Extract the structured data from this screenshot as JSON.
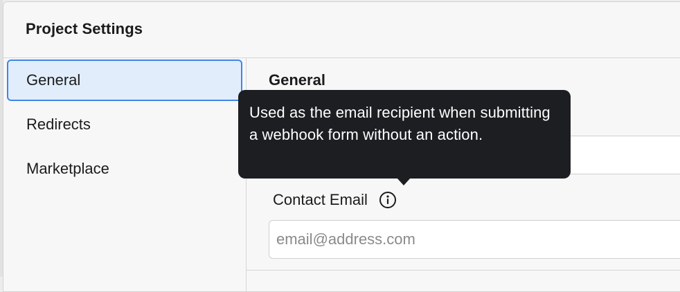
{
  "dialog": {
    "title": "Project Settings"
  },
  "sidebar": {
    "items": [
      {
        "label": "General",
        "active": true
      },
      {
        "label": "Redirects",
        "active": false
      },
      {
        "label": "Marketplace",
        "active": false
      }
    ]
  },
  "main": {
    "section_title": "General",
    "contact_email": {
      "label": "Contact Email",
      "placeholder": "email@address.com",
      "value": "",
      "info_icon": "info-circle-icon"
    }
  },
  "tooltip": {
    "text": "Used as the email recipient when submitting a webhook form without an action."
  },
  "colors": {
    "accent": "#3f86e8",
    "active_bg": "#e1edfb",
    "tooltip_bg": "#1c1e21",
    "panel_bg": "#f7f7f7"
  }
}
